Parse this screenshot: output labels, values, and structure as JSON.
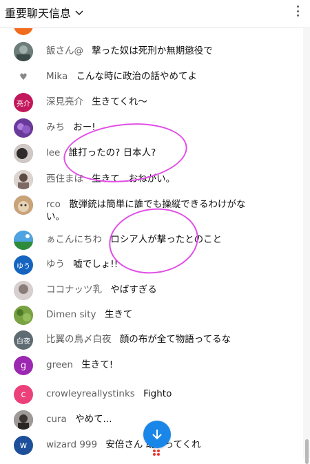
{
  "header": {
    "title": "重要聊天信息"
  },
  "messages": [
    {
      "author": "",
      "text": ""
    },
    {
      "author": "飯さん@",
      "text": "撃った奴は死刑か無期懲役で"
    },
    {
      "author": "Mika",
      "text": "こんな時に政治の話やめてよ"
    },
    {
      "author": "深見亮介",
      "avatar_text": "亮介",
      "text": "生きてくれ〜"
    },
    {
      "author": "みち",
      "text": "おー!"
    },
    {
      "author": "lee",
      "text": "誰打ったの? 日本人?"
    },
    {
      "author": "西住まほ",
      "text": "生きて...おねがい。"
    },
    {
      "author": "rco",
      "text": "散弾銃は簡単に誰でも操縦できるわけがな",
      "text2": "い。"
    },
    {
      "author": "ぁこんにちわ",
      "text": "ロシア人が撃ったとのこと"
    },
    {
      "author": "ゆう",
      "avatar_text": "ゆう",
      "text": "嘘でしょ!!"
    },
    {
      "author": "ココナッツ乳",
      "text": "やばすぎる"
    },
    {
      "author": "Dimen sity",
      "text": "生きて"
    },
    {
      "author": "比翼の鳥〆白夜",
      "avatar_text": "白夜",
      "text": "顔の布が全て物語ってるな"
    },
    {
      "author": "green",
      "avatar_text": "g",
      "text": "生きて!"
    },
    {
      "author": "crowleyreallystinks",
      "avatar_text": "c",
      "text": "Fighto"
    },
    {
      "author": "cura",
      "text": "やめて..."
    },
    {
      "author": "wizard 999",
      "avatar_text": "w",
      "text": "安倍さん  助かってくれ"
    }
  ],
  "colors": {
    "avatar_0": "#f36b1c",
    "avatar_1": "#6d7d79",
    "avatar_3": "#c2185b",
    "avatar_4": "#7b47a8",
    "avatar_5": "#8a7f7c",
    "avatar_6": "#9a8c86",
    "avatar_7": "#a07050",
    "avatar_8": "#2e7d32",
    "avatar_9": "#1565c0",
    "avatar_10": "#b0a6a4",
    "avatar_11": "#6b8f3a",
    "avatar_12": "#5e6b73",
    "avatar_13": "#9c27b0",
    "avatar_14": "#ec407a",
    "avatar_15": "#4b4b4b",
    "avatar_16": "#1e4f9a",
    "circle": "#e14ee6",
    "scroll_button": "#1a87e8"
  }
}
